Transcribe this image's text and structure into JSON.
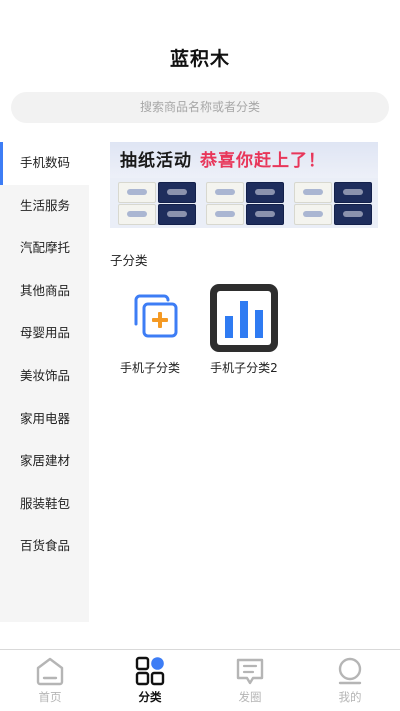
{
  "app": {
    "title": "蓝积木"
  },
  "search": {
    "placeholder": "搜索商品名称或者分类"
  },
  "sidebar": {
    "items": [
      {
        "label": "手机数码",
        "active": true
      },
      {
        "label": "生活服务"
      },
      {
        "label": "汽配摩托"
      },
      {
        "label": "其他商品"
      },
      {
        "label": "母婴用品"
      },
      {
        "label": "美妆饰品"
      },
      {
        "label": "家用电器"
      },
      {
        "label": "家居建材"
      },
      {
        "label": "服装鞋包"
      },
      {
        "label": "百货食品"
      }
    ]
  },
  "banner": {
    "text_left": "抽纸活动",
    "text_right": "恭喜你赶上了！"
  },
  "subcategories": {
    "title": "子分类",
    "items": [
      {
        "label": "手机子分类",
        "icon": "add-copy-icon"
      },
      {
        "label": "手机子分类2",
        "icon": "bar-chart-icon"
      }
    ]
  },
  "tabbar": {
    "items": [
      {
        "label": "首页",
        "icon": "home-icon"
      },
      {
        "label": "分类",
        "icon": "category-icon",
        "active": true
      },
      {
        "label": "发圈",
        "icon": "message-icon"
      },
      {
        "label": "我的",
        "icon": "profile-icon"
      }
    ]
  },
  "colors": {
    "accent": "#3d7df5",
    "orange": "#f59a23",
    "inactive": "#b5b5b5"
  }
}
